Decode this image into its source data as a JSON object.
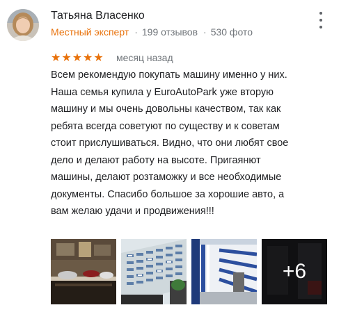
{
  "review": {
    "author": {
      "name": "Татьяна Власенко",
      "badge": "Местный эксперт",
      "reviews_count": "199 отзывов",
      "photos_count": "530 фото"
    },
    "separator": "·",
    "rating": {
      "value": 5,
      "max": 5,
      "stars_text": "★★★★★",
      "color": "#e8710a"
    },
    "date": "месяц назад",
    "text_lines": [
      "Всем рекомендую покупать машину именно у них.",
      "Наша семья купила у EuroAutoPark уже вторую",
      "машину и мы очень довольны качеством, так как",
      "ребята всегда советуют по существу и к советам",
      "стоит прислушиваться. Видно, что они любят свое",
      "дело и делают работу на высоте. Пригаянют",
      "машины, делают розтаможку и все необходимые",
      "документы. Спасибо большое за хорошие авто, а",
      "вам желаю удачи и продвижения!!!"
    ],
    "photos": {
      "more_label": "+6"
    },
    "icons": {
      "menu": "more-vertical-icon",
      "star": "star-icon"
    },
    "colors": {
      "accent": "#e8710a",
      "text": "#202124",
      "secondary": "#70757a"
    }
  }
}
